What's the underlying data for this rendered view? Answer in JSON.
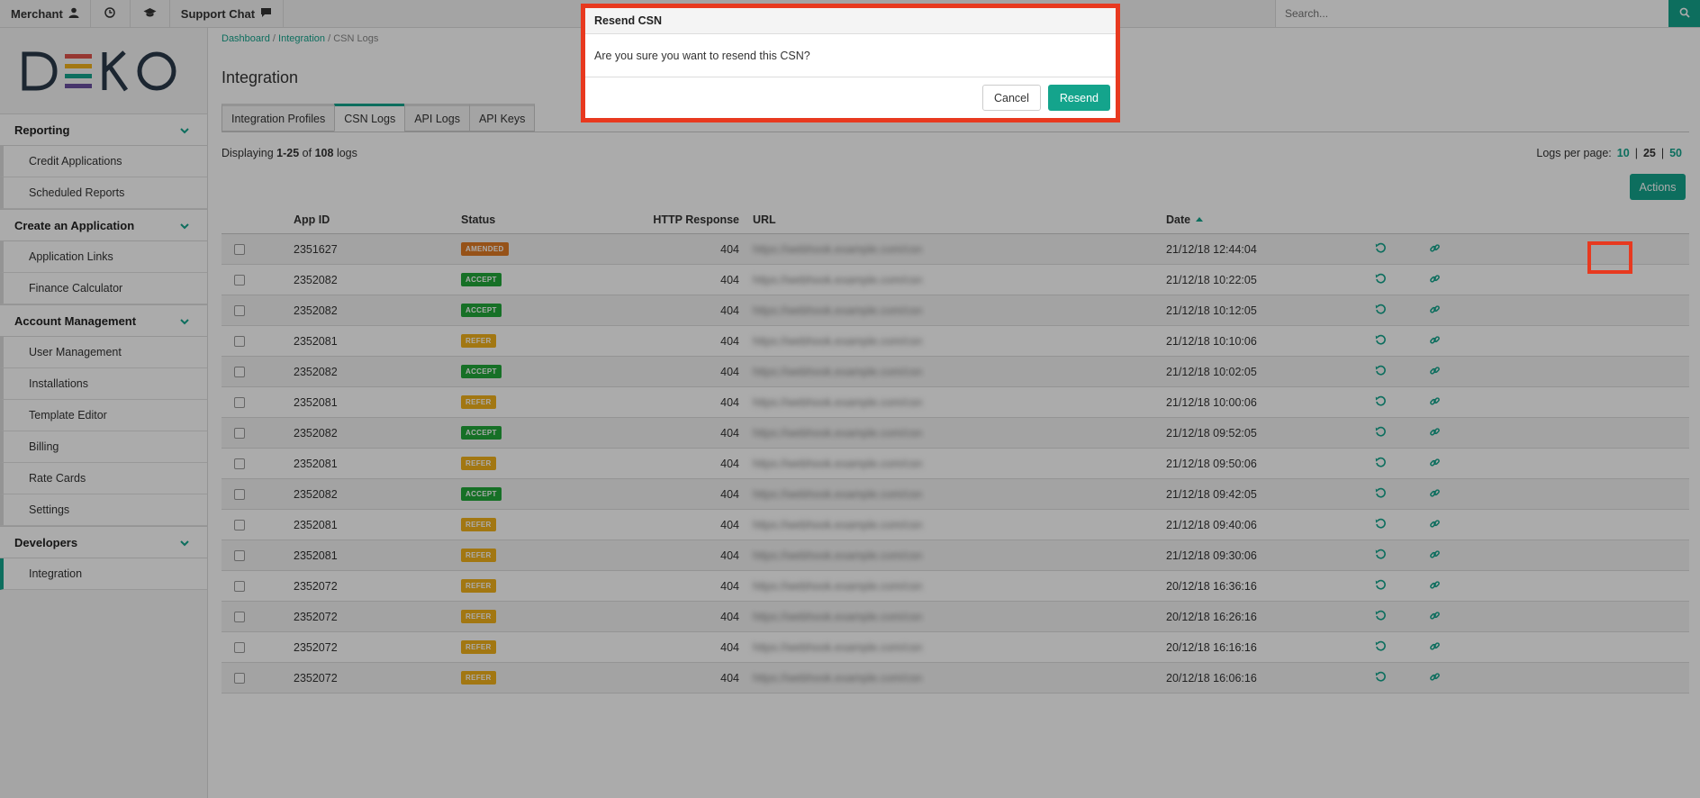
{
  "topbar": {
    "merchant_label": "Merchant",
    "support_label": "Support Chat",
    "search_placeholder": "Search..."
  },
  "sidebar": {
    "logo_text": "DEKO",
    "sections": [
      {
        "title": "Reporting",
        "items": [
          "Credit Applications",
          "Scheduled Reports"
        ]
      },
      {
        "title": "Create an Application",
        "items": [
          "Application Links",
          "Finance Calculator"
        ]
      },
      {
        "title": "Account Management",
        "items": [
          "User Management",
          "Installations",
          "Template Editor",
          "Billing",
          "Rate Cards",
          "Settings"
        ]
      },
      {
        "title": "Developers",
        "items": [
          "Integration"
        ]
      }
    ]
  },
  "breadcrumb": {
    "dashboard": "Dashboard",
    "integration": "Integration",
    "current": "CSN Logs",
    "sep": "/"
  },
  "page": {
    "title": "Integration",
    "tabs": [
      "Integration Profiles",
      "CSN Logs",
      "API Logs",
      "API Keys"
    ],
    "displaying_prefix": "Displaying",
    "displaying_range": "1-25",
    "displaying_of": "of",
    "displaying_total": "108",
    "displaying_suffix": "logs",
    "perpage_label": "Logs per page:",
    "perpage_options": [
      "10",
      "25",
      "50"
    ],
    "perpage_sep": "|",
    "actions_label": "Actions"
  },
  "table": {
    "headers": {
      "app_id": "App ID",
      "status": "Status",
      "http": "HTTP Response",
      "url": "URL",
      "date": "Date"
    },
    "rows": [
      {
        "app_id": "2351627",
        "status": "AMENDED",
        "http": "404",
        "url": "https://webhook.example.com/csn",
        "date": "21/12/18 12:44:04"
      },
      {
        "app_id": "2352082",
        "status": "ACCEPT",
        "http": "404",
        "url": "https://webhook.example.com/csn",
        "date": "21/12/18 10:22:05"
      },
      {
        "app_id": "2352082",
        "status": "ACCEPT",
        "http": "404",
        "url": "https://webhook.example.com/csn",
        "date": "21/12/18 10:12:05"
      },
      {
        "app_id": "2352081",
        "status": "REFER",
        "http": "404",
        "url": "https://webhook.example.com/csn",
        "date": "21/12/18 10:10:06"
      },
      {
        "app_id": "2352082",
        "status": "ACCEPT",
        "http": "404",
        "url": "https://webhook.example.com/csn",
        "date": "21/12/18 10:02:05"
      },
      {
        "app_id": "2352081",
        "status": "REFER",
        "http": "404",
        "url": "https://webhook.example.com/csn",
        "date": "21/12/18 10:00:06"
      },
      {
        "app_id": "2352082",
        "status": "ACCEPT",
        "http": "404",
        "url": "https://webhook.example.com/csn",
        "date": "21/12/18 09:52:05"
      },
      {
        "app_id": "2352081",
        "status": "REFER",
        "http": "404",
        "url": "https://webhook.example.com/csn",
        "date": "21/12/18 09:50:06"
      },
      {
        "app_id": "2352082",
        "status": "ACCEPT",
        "http": "404",
        "url": "https://webhook.example.com/csn",
        "date": "21/12/18 09:42:05"
      },
      {
        "app_id": "2352081",
        "status": "REFER",
        "http": "404",
        "url": "https://webhook.example.com/csn",
        "date": "21/12/18 09:40:06"
      },
      {
        "app_id": "2352081",
        "status": "REFER",
        "http": "404",
        "url": "https://webhook.example.com/csn",
        "date": "21/12/18 09:30:06"
      },
      {
        "app_id": "2352072",
        "status": "REFER",
        "http": "404",
        "url": "https://webhook.example.com/csn",
        "date": "20/12/18 16:36:16"
      },
      {
        "app_id": "2352072",
        "status": "REFER",
        "http": "404",
        "url": "https://webhook.example.com/csn",
        "date": "20/12/18 16:26:16"
      },
      {
        "app_id": "2352072",
        "status": "REFER",
        "http": "404",
        "url": "https://webhook.example.com/csn",
        "date": "20/12/18 16:16:16"
      },
      {
        "app_id": "2352072",
        "status": "REFER",
        "http": "404",
        "url": "https://webhook.example.com/csn",
        "date": "20/12/18 16:06:16"
      }
    ],
    "status_colors": {
      "AMENDED": "#e07b24",
      "ACCEPT": "#22a83a",
      "REFER": "#f2b21b"
    }
  },
  "modal": {
    "title": "Resend CSN",
    "message": "Are you sure you want to resend this CSN?",
    "cancel_label": "Cancel",
    "confirm_label": "Resend"
  },
  "colors": {
    "accent": "#14a48c",
    "highlight": "#e8391f"
  }
}
